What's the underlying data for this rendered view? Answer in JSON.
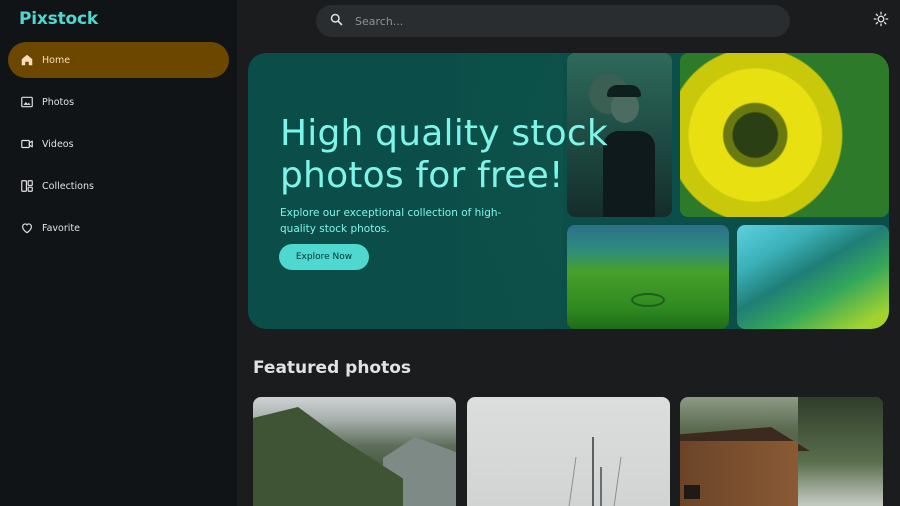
{
  "app": {
    "brand": "Pixstock"
  },
  "sidebar": {
    "items": [
      {
        "label": "Home",
        "icon": "home-icon",
        "active": true
      },
      {
        "label": "Photos",
        "icon": "image-icon",
        "active": false
      },
      {
        "label": "Videos",
        "icon": "video-icon",
        "active": false
      },
      {
        "label": "Collections",
        "icon": "collections-icon",
        "active": false
      },
      {
        "label": "Favorite",
        "icon": "heart-icon",
        "active": false
      }
    ]
  },
  "search": {
    "placeholder": "Search..."
  },
  "hero": {
    "title": "High quality stock photos for free!",
    "subtitle": "Explore our exceptional collection of high-quality stock photos.",
    "cta": "Explore Now"
  },
  "featured": {
    "title": "Featured photos"
  },
  "colors": {
    "accent": "#4fd8cf",
    "active_nav_bg": "#6b4700",
    "hero_bg": "#0b4d48",
    "page_bg": "#1a1c1e",
    "sidebar_bg": "#111416"
  }
}
